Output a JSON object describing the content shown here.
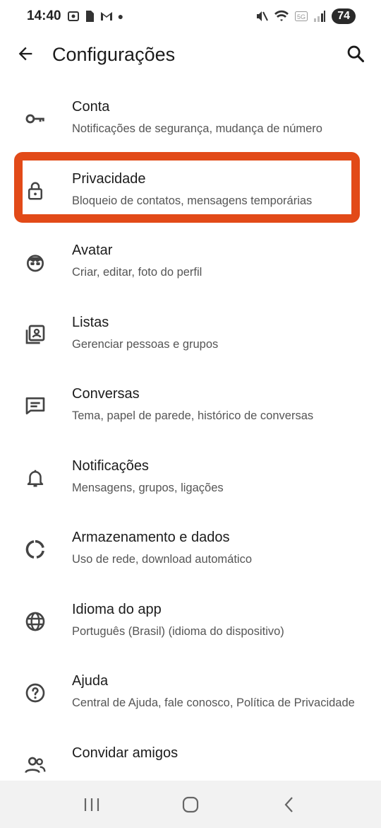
{
  "status_bar": {
    "time": "14:40",
    "battery": "74"
  },
  "app_bar": {
    "title": "Configurações"
  },
  "settings": [
    {
      "icon": "key-icon",
      "label": "Conta",
      "sub": "Notificações de segurança, mudança de número"
    },
    {
      "icon": "lock-icon",
      "label": "Privacidade",
      "sub": "Bloqueio de contatos, mensagens temporárias"
    },
    {
      "icon": "avatar-face-icon",
      "label": "Avatar",
      "sub": "Criar, editar, foto do perfil"
    },
    {
      "icon": "contact-list-icon",
      "label": "Listas",
      "sub": "Gerenciar pessoas e grupos"
    },
    {
      "icon": "chat-icon",
      "label": "Conversas",
      "sub": "Tema, papel de parede, histórico de conversas"
    },
    {
      "icon": "bell-icon",
      "label": "Notificações",
      "sub": "Mensagens, grupos, ligações"
    },
    {
      "icon": "storage-circle-icon",
      "label": "Armazenamento e dados",
      "sub": "Uso de rede, download automático"
    },
    {
      "icon": "globe-icon",
      "label": "Idioma do app",
      "sub": "Português (Brasil) (idioma do dispositivo)"
    },
    {
      "icon": "help-icon",
      "label": "Ajuda",
      "sub": "Central de Ajuda, fale conosco, Política de Privacidade"
    },
    {
      "icon": "people-icon",
      "label": "Convidar amigos",
      "sub": ""
    }
  ],
  "colors": {
    "highlight": "#e24a18",
    "nav_bar": "#f2f2f2"
  }
}
